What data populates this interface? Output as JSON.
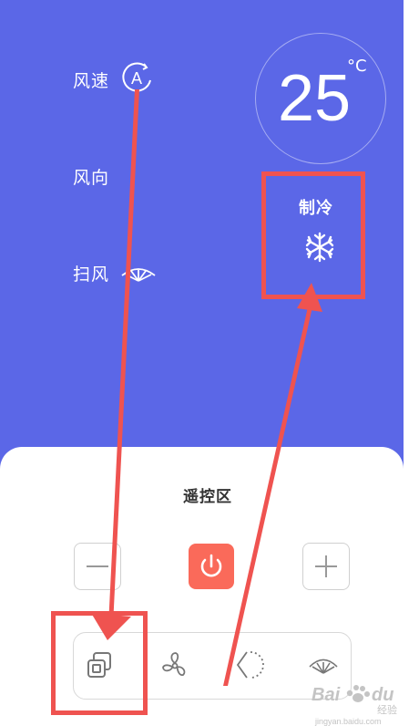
{
  "status": {
    "wind_speed_label": "风速",
    "wind_direction_label": "风向",
    "sweep_label": "扫风",
    "auto_badge": "A"
  },
  "temperature": {
    "value": "25",
    "unit": "°C"
  },
  "mode": {
    "label": "制冷",
    "icon": "snowflake-icon"
  },
  "remote": {
    "title": "遥控区",
    "buttons": [
      "minus-icon",
      "power-icon",
      "plus-icon"
    ],
    "function_bar": [
      "mode-icon",
      "fan-icon",
      "wind-direction-icon",
      "sweep-icon"
    ]
  },
  "annotation": {
    "color": "#ef5350"
  },
  "watermark": {
    "brand": "Bai",
    "brand_suffix": "du",
    "sub": "经验",
    "url": "jingyan.baidu.com"
  },
  "colors": {
    "background_top": "#5b67e7",
    "power_button": "#fa6a5a"
  }
}
